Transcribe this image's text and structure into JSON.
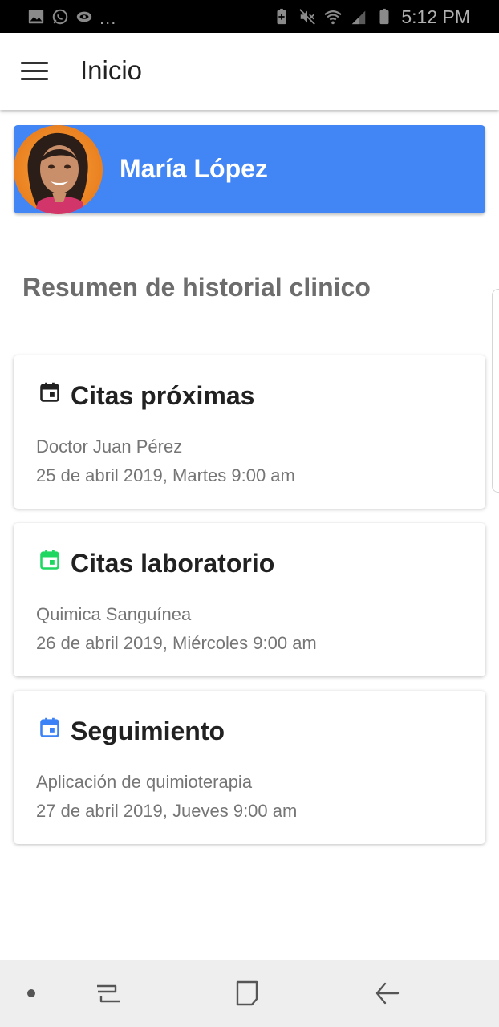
{
  "status_bar": {
    "time": "5:12 PM",
    "left_icons": [
      "gallery-icon",
      "whatsapp-icon",
      "eye-icon"
    ],
    "more": "...",
    "right_icons": [
      "battery-saver-icon",
      "mute-icon",
      "wifi-icon",
      "signal-icon",
      "battery-icon"
    ]
  },
  "app_bar": {
    "title": "Inicio",
    "menu_icon": "menu-icon"
  },
  "profile": {
    "name": "María López",
    "background_color": "#4285f4"
  },
  "section": {
    "title": "Resumen de historial clinico"
  },
  "cards": [
    {
      "title": "Citas próximas",
      "icon": "calendar-icon",
      "icon_color": "#212121",
      "line1": "Doctor Juan Pérez",
      "line2": "25 de abril 2019, Martes 9:00 am"
    },
    {
      "title": "Citas laboratorio",
      "icon": "calendar-icon",
      "icon_color": "#1ed760",
      "line1": "Quimica Sanguínea",
      "line2": "26 de abril 2019, Miércoles 9:00 am"
    },
    {
      "title": "Seguimiento",
      "icon": "calendar-icon",
      "icon_color": "#3b82f6",
      "line1": "Aplicación de quimioterapia",
      "line2": "27 de abril 2019, Jueves 9:00 am"
    }
  ],
  "nav_bar": {
    "items": [
      "dot-icon",
      "recents-icon",
      "home-icon",
      "back-icon"
    ]
  }
}
